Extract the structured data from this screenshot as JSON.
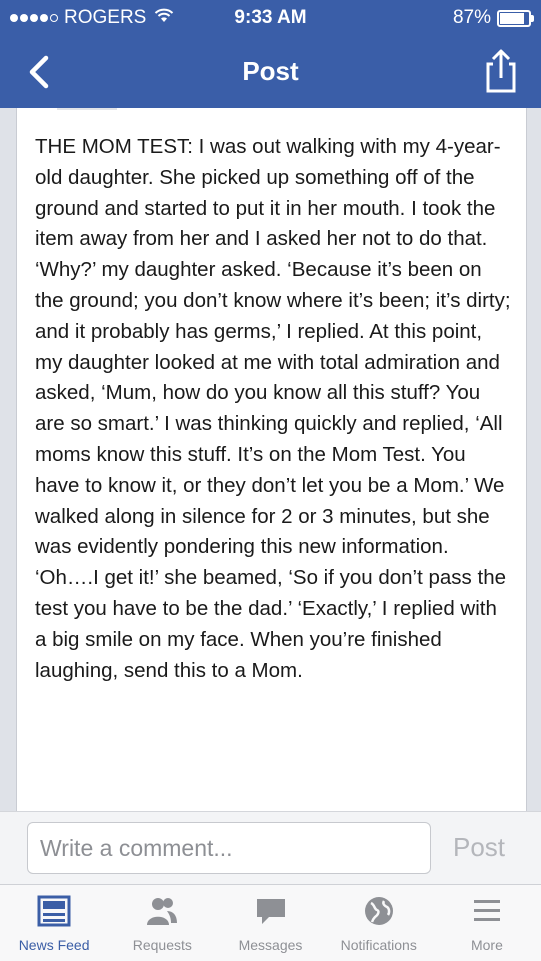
{
  "status": {
    "carrier": "ROGERS",
    "time": "9:33 AM",
    "battery": "87%",
    "battery_level": 0.87
  },
  "nav": {
    "title": "Post"
  },
  "post": {
    "text": "THE MOM TEST: I was out walking with my 4-year-old daughter. She picked up something off of the ground and started to put it in her mouth. I took the item away from her and I asked her not to do that. ‘Why?’ my daughter asked. ‘Because it’s been on the ground; you don’t know where it’s been; it’s dirty; and it probably has germs,’ I replied. At this point, my daughter looked at me with total admiration and asked, ‘Mum, how do you know all this stuff? You are so smart.’ I was thinking quickly and replied, ‘All moms know this stuff. It’s on the Mom Test. You have to know it, or they don’t let you be a Mom.’ We walked along in silence for 2 or 3 minutes, but she was evidently pondering this new information. ‘Oh….I get it!’ she beamed, ‘So if you don’t pass the test you have to be the dad.’ ‘Exactly,’ I replied with a big smile on my face. When you’re finished laughing, send this to a Mom."
  },
  "comment": {
    "placeholder": "Write a comment...",
    "post_label": "Post"
  },
  "tabs": [
    {
      "label": "News Feed",
      "icon": "news-feed-icon"
    },
    {
      "label": "Requests",
      "icon": "friend-requests-icon"
    },
    {
      "label": "Messages",
      "icon": "messages-icon"
    },
    {
      "label": "Notifications",
      "icon": "globe-icon"
    },
    {
      "label": "More",
      "icon": "menu-icon"
    }
  ],
  "colors": {
    "brand": "#3a5ea8",
    "active_tab": "#3b5ea6",
    "inactive_tab": "#8e9095"
  }
}
